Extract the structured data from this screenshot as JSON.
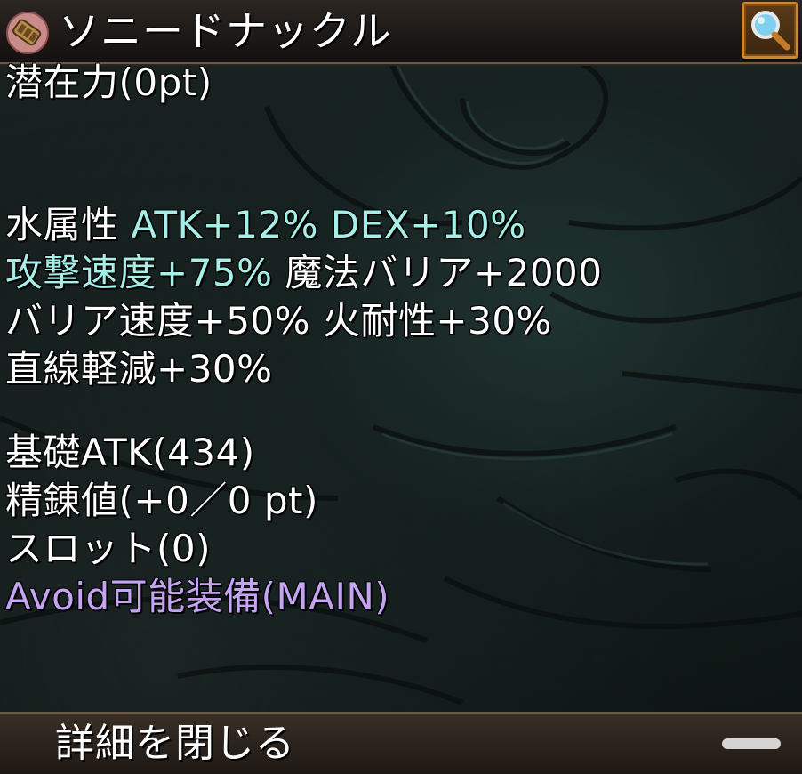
{
  "item": {
    "name": "ソニードナックル",
    "icon": "knuckle-gauntlet-icon"
  },
  "header": {
    "inspect_icon": "magnifier-icon"
  },
  "details": {
    "potential": "潜在力(0pt)",
    "stats": {
      "element_label": "水属性",
      "element_stats": "ATK+12% DEX+10%",
      "attack_speed": "攻撃速度+75%",
      "magic_barrier": "魔法バリア+2000",
      "barrier_speed": "バリア速度+50%",
      "fire_resistance": "火耐性+30%",
      "linear_reduction": "直線軽減+30%"
    },
    "base_atk": "基礎ATK(434)",
    "refine": "精錬値(+0／0 pt)",
    "slots": "スロット(0)",
    "avoid": "Avoid可能装備(MAIN)"
  },
  "footer": {
    "close_label": "詳細を閉じる"
  },
  "colors": {
    "cyan": "#a6efe9",
    "purple": "#c6a4f4",
    "frame_gold": "#c9892f"
  }
}
